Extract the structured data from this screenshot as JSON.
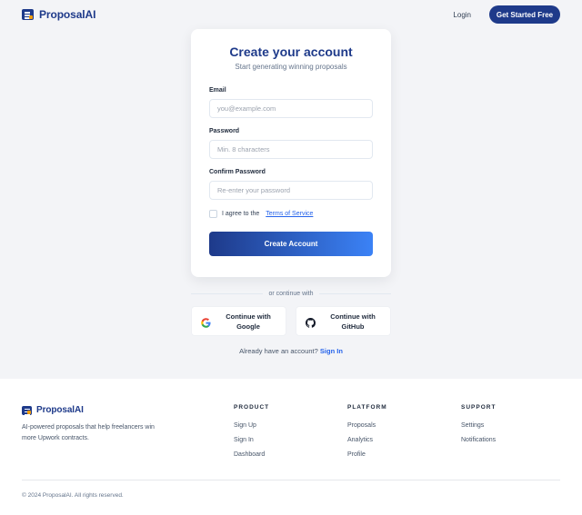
{
  "header": {
    "brand": "ProposalAI",
    "login_label": "Login",
    "cta_label": "Get Started Free"
  },
  "card": {
    "title": "Create your account",
    "subtitle": "Start generating winning proposals",
    "email": {
      "label": "Email",
      "placeholder": "you@example.com",
      "value": ""
    },
    "password": {
      "label": "Password",
      "placeholder": "Min. 8 characters",
      "value": ""
    },
    "confirm": {
      "label": "Confirm Password",
      "placeholder": "Re-enter your password",
      "value": ""
    },
    "terms_prefix": "I agree to the",
    "terms_link": "Terms of Service",
    "terms_checked": false,
    "submit_label": "Create Account"
  },
  "divider_text": "or continue with",
  "social": {
    "google_label": "Continue with Google",
    "github_label": "Continue with GitHub",
    "google_icon": "google-icon",
    "github_icon": "github-icon"
  },
  "signin": {
    "prompt": "Already have an account?",
    "link": "Sign In"
  },
  "footer": {
    "brand": "ProposalAI",
    "tagline": "AI-powered proposals that help freelancers win more Upwork contracts.",
    "columns": [
      {
        "title": "PRODUCT",
        "links": [
          "Sign Up",
          "Sign In",
          "Dashboard"
        ]
      },
      {
        "title": "PLATFORM",
        "links": [
          "Proposals",
          "Analytics",
          "Profile"
        ]
      },
      {
        "title": "SUPPORT",
        "links": [
          "Settings",
          "Notifications"
        ]
      }
    ],
    "copyright": "© 2024 ProposalAI. All rights reserved."
  },
  "colors": {
    "brand_navy": "#1e3a8a",
    "accent_blue": "#3b82f6",
    "link_blue": "#2563eb",
    "page_bg": "#f3f4f7"
  }
}
